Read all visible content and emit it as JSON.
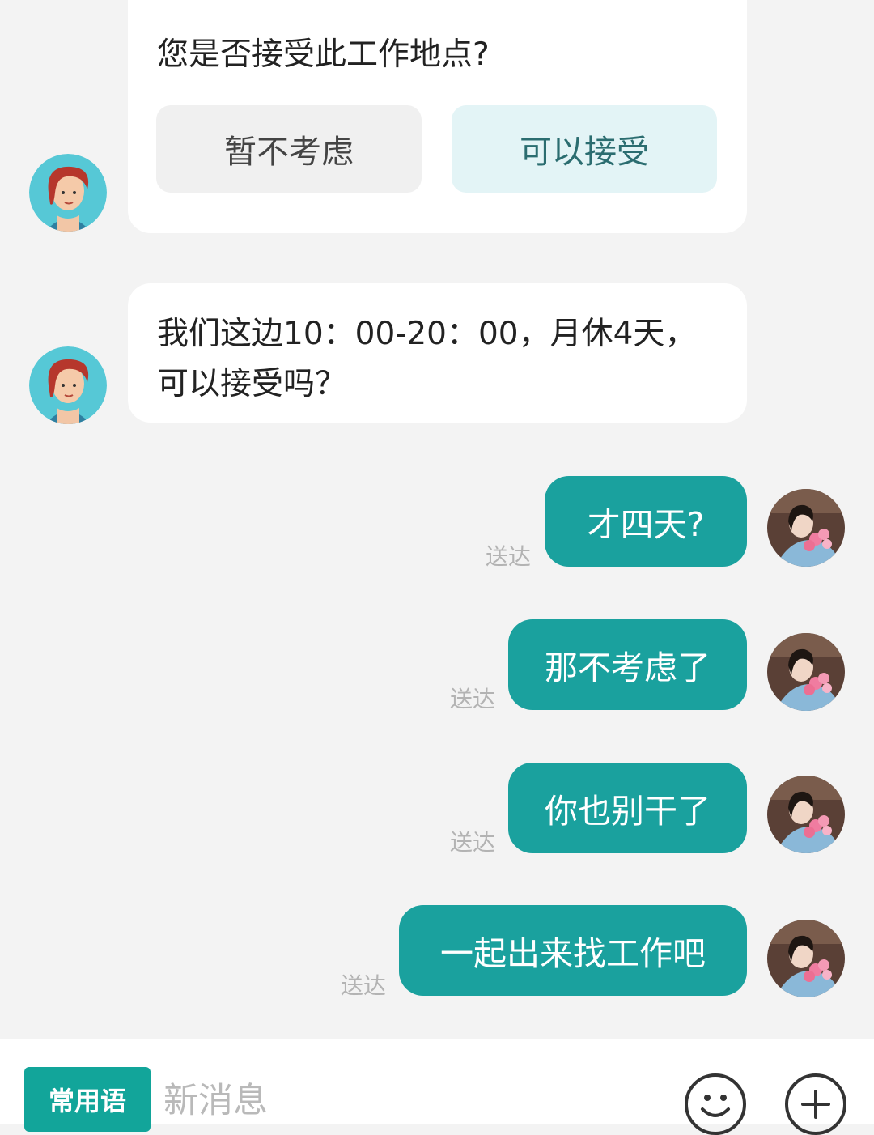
{
  "question_card": {
    "question": "您是否接受此工作地点?",
    "reject_label": "暂不考虑",
    "accept_label": "可以接受"
  },
  "recruiter_message": {
    "text": "我们这边10：00-20：00，月休4天，可以接受吗？"
  },
  "user_messages": [
    {
      "text": "才四天?",
      "status": "送达"
    },
    {
      "text": "那不考虑了",
      "status": "送达"
    },
    {
      "text": "你也别干了",
      "status": "送达"
    },
    {
      "text": "一起出来找工作吧",
      "status": "送达"
    }
  ],
  "input_bar": {
    "phrases_label": "常用语",
    "placeholder": "新消息",
    "emoji_icon": "smile-icon",
    "add_icon": "plus-icon"
  },
  "colors": {
    "bubble": "#1aa19e",
    "phrase_button": "#12a59a",
    "background": "#f3f3f3"
  }
}
